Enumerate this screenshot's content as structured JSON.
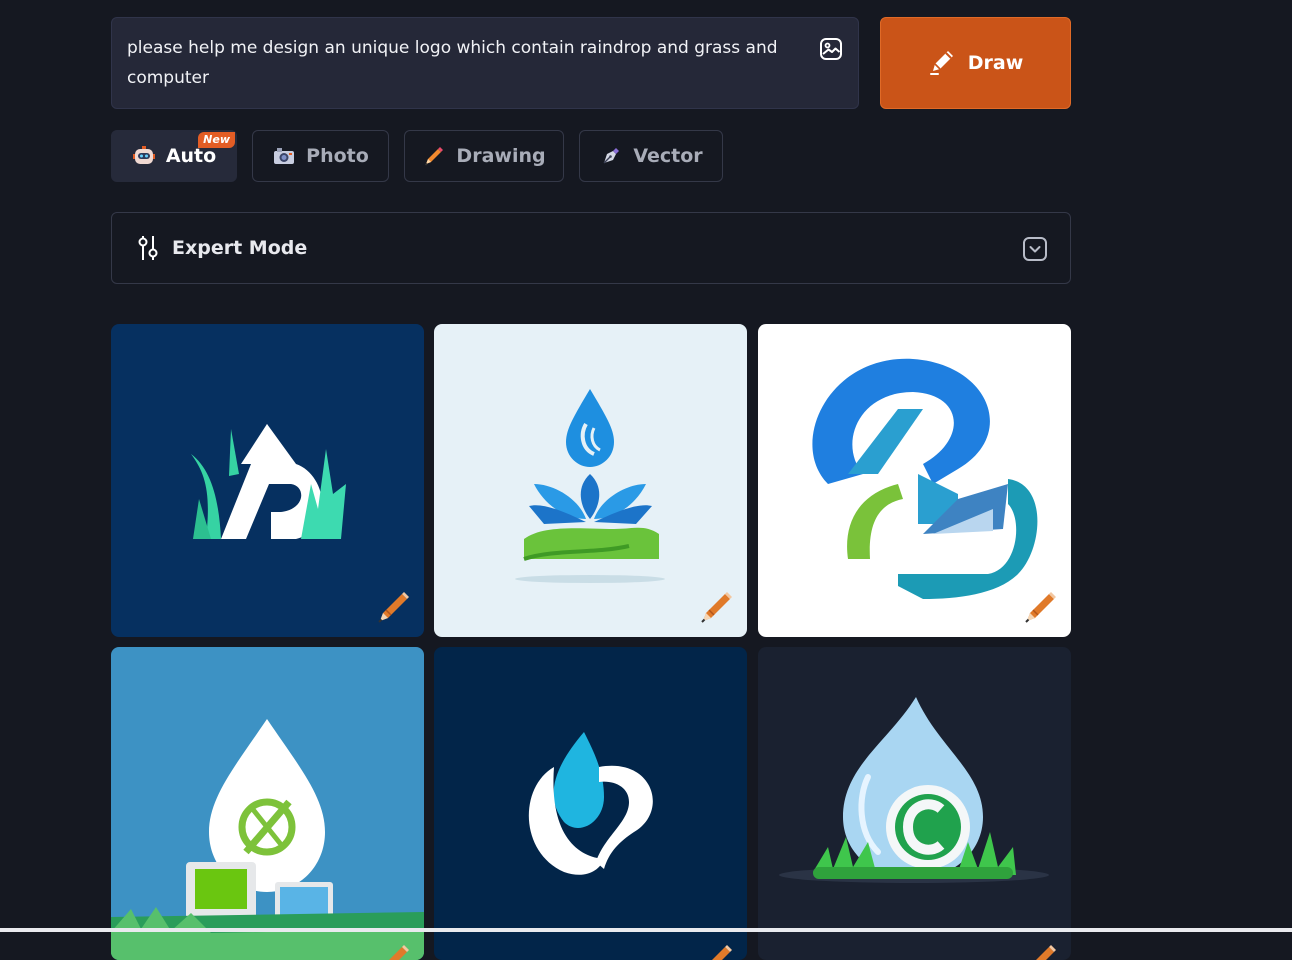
{
  "prompt": {
    "text": "please help me design an unique logo which contain raindrop and grass and computer",
    "upload_icon": "image-upload-icon"
  },
  "draw_button": {
    "label": "Draw",
    "icon": "pencil-icon"
  },
  "mode_tabs": [
    {
      "label": "Auto",
      "icon": "robot-icon",
      "badge": "New",
      "active": true
    },
    {
      "label": "Photo",
      "icon": "camera-icon",
      "active": false
    },
    {
      "label": "Drawing",
      "icon": "crayon-icon",
      "active": false
    },
    {
      "label": "Vector",
      "icon": "pen-nib-icon",
      "active": false
    }
  ],
  "expert_mode": {
    "label": "Expert Mode",
    "icon": "sliders-icon",
    "toggle_icon": "chevron-down-icon"
  },
  "colors": {
    "background": "#151821",
    "accent": "#ca5418",
    "panel": "#252838",
    "badge": "#e35d25"
  },
  "gallery": [
    {
      "description": "grass and triangle logo on navy",
      "bg": "#063060"
    },
    {
      "description": "raindrop over plant and grass",
      "bg": "#e6f1f7"
    },
    {
      "description": "blue and green abstract swirl",
      "bg": "#ffffff"
    },
    {
      "description": "raindrop with leaf over computers",
      "bg": "#3d92c4"
    },
    {
      "description": "cyan droplet on navy",
      "bg": "#022549"
    },
    {
      "description": "3d raindrop with letter C on grass",
      "bg": "#1a2130"
    }
  ]
}
